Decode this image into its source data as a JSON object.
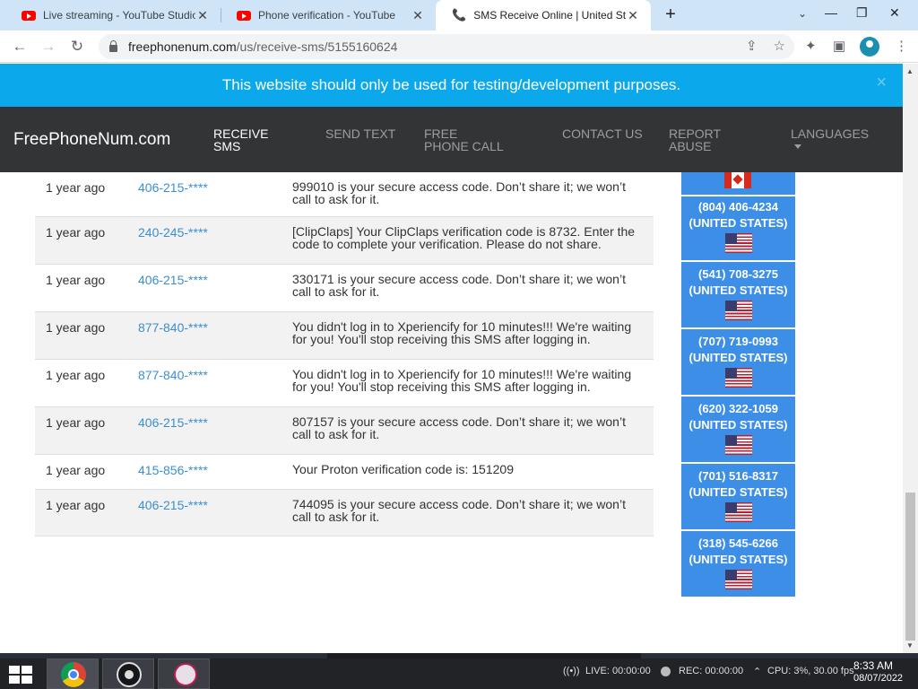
{
  "browser": {
    "tabs": [
      {
        "title": "Live streaming - YouTube Studio",
        "icon": "youtube-icon",
        "active": false
      },
      {
        "title": "Phone verification - YouTube",
        "icon": "youtube-icon",
        "active": false
      },
      {
        "title": "SMS Receive Online | United Stat",
        "icon": "phone-icon",
        "active": true
      }
    ],
    "url_host": "freephonenum.com",
    "url_path": "/us/receive-sms/5155160624"
  },
  "banner": {
    "text": "This website should only be used for testing/development purposes.",
    "close": "×"
  },
  "site": {
    "brand": "FreePhoneNum.com",
    "nav": [
      "RECEIVE SMS",
      "SEND TEXT",
      "FREE PHONE CALL",
      "CONTACT US",
      "REPORT ABUSE",
      "LANGUAGES"
    ]
  },
  "messages": [
    {
      "ago": "1 year ago",
      "from": "406-215-****",
      "text": "999010 is your secure access code. Don’t share it; we won’t call to ask for it."
    },
    {
      "ago": "1 year ago",
      "from": "240-245-****",
      "text": "[ClipClaps] Your ClipClaps verification code is 8732. Enter the code to complete your verification. Please do not share."
    },
    {
      "ago": "1 year ago",
      "from": "406-215-****",
      "text": "330171 is your secure access code. Don’t share it; we won’t call to ask for it."
    },
    {
      "ago": "1 year ago",
      "from": "877-840-****",
      "text": "You didn't log in to Xperiencify for 10 minutes!!! We're waiting for you! You'll stop receiving this SMS after logging in."
    },
    {
      "ago": "1 year ago",
      "from": "877-840-****",
      "text": "You didn't log in to Xperiencify for 10 minutes!!! We're waiting for you! You'll stop receiving this SMS after logging in."
    },
    {
      "ago": "1 year ago",
      "from": "406-215-****",
      "text": "807157 is your secure access code. Don’t share it; we won’t call to ask for it."
    },
    {
      "ago": "1 year ago",
      "from": "415-856-****",
      "text": "Your Proton verification code is: 151209"
    },
    {
      "ago": "1 year ago",
      "from": "406-215-****",
      "text": "744095 is your secure access code. Don’t share it; we won’t call to ask for it."
    }
  ],
  "numbers": [
    {
      "number": "(804) 406-4234",
      "country": "(UNITED STATES)"
    },
    {
      "number": "(541) 708-3275",
      "country": "(UNITED STATES)"
    },
    {
      "number": "(707) 719-0993",
      "country": "(UNITED STATES)"
    },
    {
      "number": "(620) 322-1059",
      "country": "(UNITED STATES)"
    },
    {
      "number": "(701) 516-8317",
      "country": "(UNITED STATES)"
    },
    {
      "number": "(318) 545-6266",
      "country": "(UNITED STATES)"
    }
  ],
  "taskbar": {
    "live": "LIVE: 00:00:00",
    "rec": "REC: 00:00:00",
    "cpu": "CPU: 3%, 30.00 fps",
    "time": "8:33 AM",
    "date": "08/07/2022"
  },
  "colors": {
    "banner": "#0ba8ec",
    "nav": "#333436",
    "numbers_panel": "#3d8ee6",
    "link": "#3b8ed1"
  }
}
